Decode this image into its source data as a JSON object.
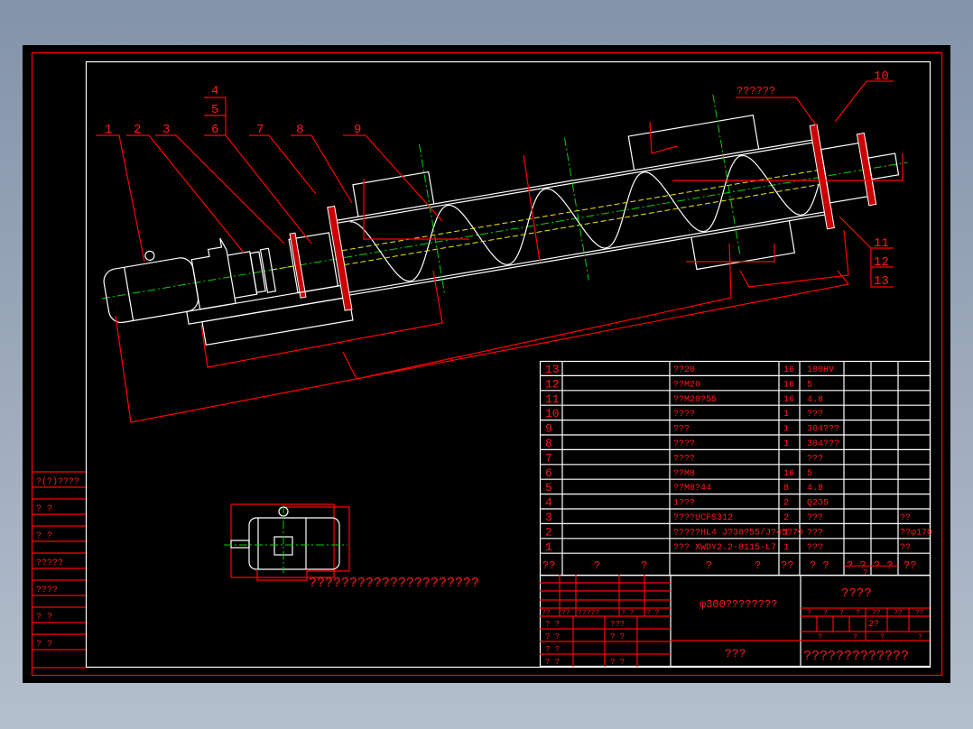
{
  "colors": {
    "line": "#ffffff",
    "annotation": "#ff0000",
    "centerline": "#00d000",
    "hidden": "#e8e800",
    "sheet": "#000000"
  },
  "callouts": {
    "c1": "1",
    "c2": "2",
    "c3": "3",
    "c4": "4",
    "c5": "5",
    "c6": "6",
    "c7": "7",
    "c8": "8",
    "c9": "9",
    "c10": "10",
    "c11": "11",
    "c12": "12",
    "c13": "13",
    "top_note": "??????"
  },
  "motor_view": {
    "note": "?????????????????????"
  },
  "left_strip": [
    "?(?)????",
    "?  ?",
    "?  ?",
    "?????",
    "????",
    "?  ?",
    "?  ?"
  ],
  "parts": [
    {
      "no": "13",
      "name": "??20",
      "qty": "16",
      "material": "100HV",
      "remark": ""
    },
    {
      "no": "12",
      "name": "??M20",
      "qty": "16",
      "material": "5",
      "remark": ""
    },
    {
      "no": "11",
      "name": "??M20?55",
      "qty": "16",
      "material": "4.8",
      "remark": ""
    },
    {
      "no": "10",
      "name": "????",
      "qty": "1",
      "material": "???",
      "remark": ""
    },
    {
      "no": "9",
      "name": "???",
      "qty": "1",
      "material": "304???",
      "remark": ""
    },
    {
      "no": "8",
      "name": "????",
      "qty": "1",
      "material": "304???",
      "remark": ""
    },
    {
      "no": "7",
      "name": "????",
      "qty": "",
      "material": "???",
      "remark": ""
    },
    {
      "no": "6",
      "name": "??M8",
      "qty": "16",
      "material": "5",
      "remark": ""
    },
    {
      "no": "5",
      "name": "??M8?44",
      "qty": "8",
      "material": "4.8",
      "remark": ""
    },
    {
      "no": "4",
      "name": "1???",
      "qty": "2",
      "material": "Q235",
      "remark": ""
    },
    {
      "no": "3",
      "name": "????UCFS312",
      "qty": "2",
      "material": "???",
      "remark": "??"
    },
    {
      "no": "2",
      "name": "?????HL4  J?38?55/J?45?70",
      "qty": "1",
      "material": "???",
      "remark": "??φ170"
    },
    {
      "no": "1",
      "name": "???  XWDY2.2-8115-L7",
      "qty": "1",
      "material": "???",
      "remark": "??"
    }
  ],
  "parts_header": {
    "no": "??",
    "code_a": "?",
    "code_b": "?",
    "name_a": "?",
    "name_b": "?",
    "qty": "??",
    "material": "?  ?",
    "unit_wt": "? ?",
    "total_wt": "? ?",
    "wt_sub": "?",
    "remark": "??"
  },
  "title_block": {
    "sign_header": [
      "??",
      "??",
      "?????",
      "?  ?",
      "?  ?"
    ],
    "sign_rows": [
      [
        "?  ?",
        "???"
      ],
      [
        "?  ?",
        "?  ?"
      ],
      [
        "?  ?",
        ""
      ],
      [
        "?  ?",
        "?  ?"
      ]
    ],
    "drawing_title": "φ300????????",
    "company_label": "???",
    "org": "????",
    "stage_header": [
      "?",
      "?",
      "?",
      "?",
      "??",
      "??",
      "??"
    ],
    "scale_value": "2?",
    "sheet_row": [
      "?",
      "?",
      "?",
      "?"
    ],
    "drawing_no": "?????????????"
  }
}
